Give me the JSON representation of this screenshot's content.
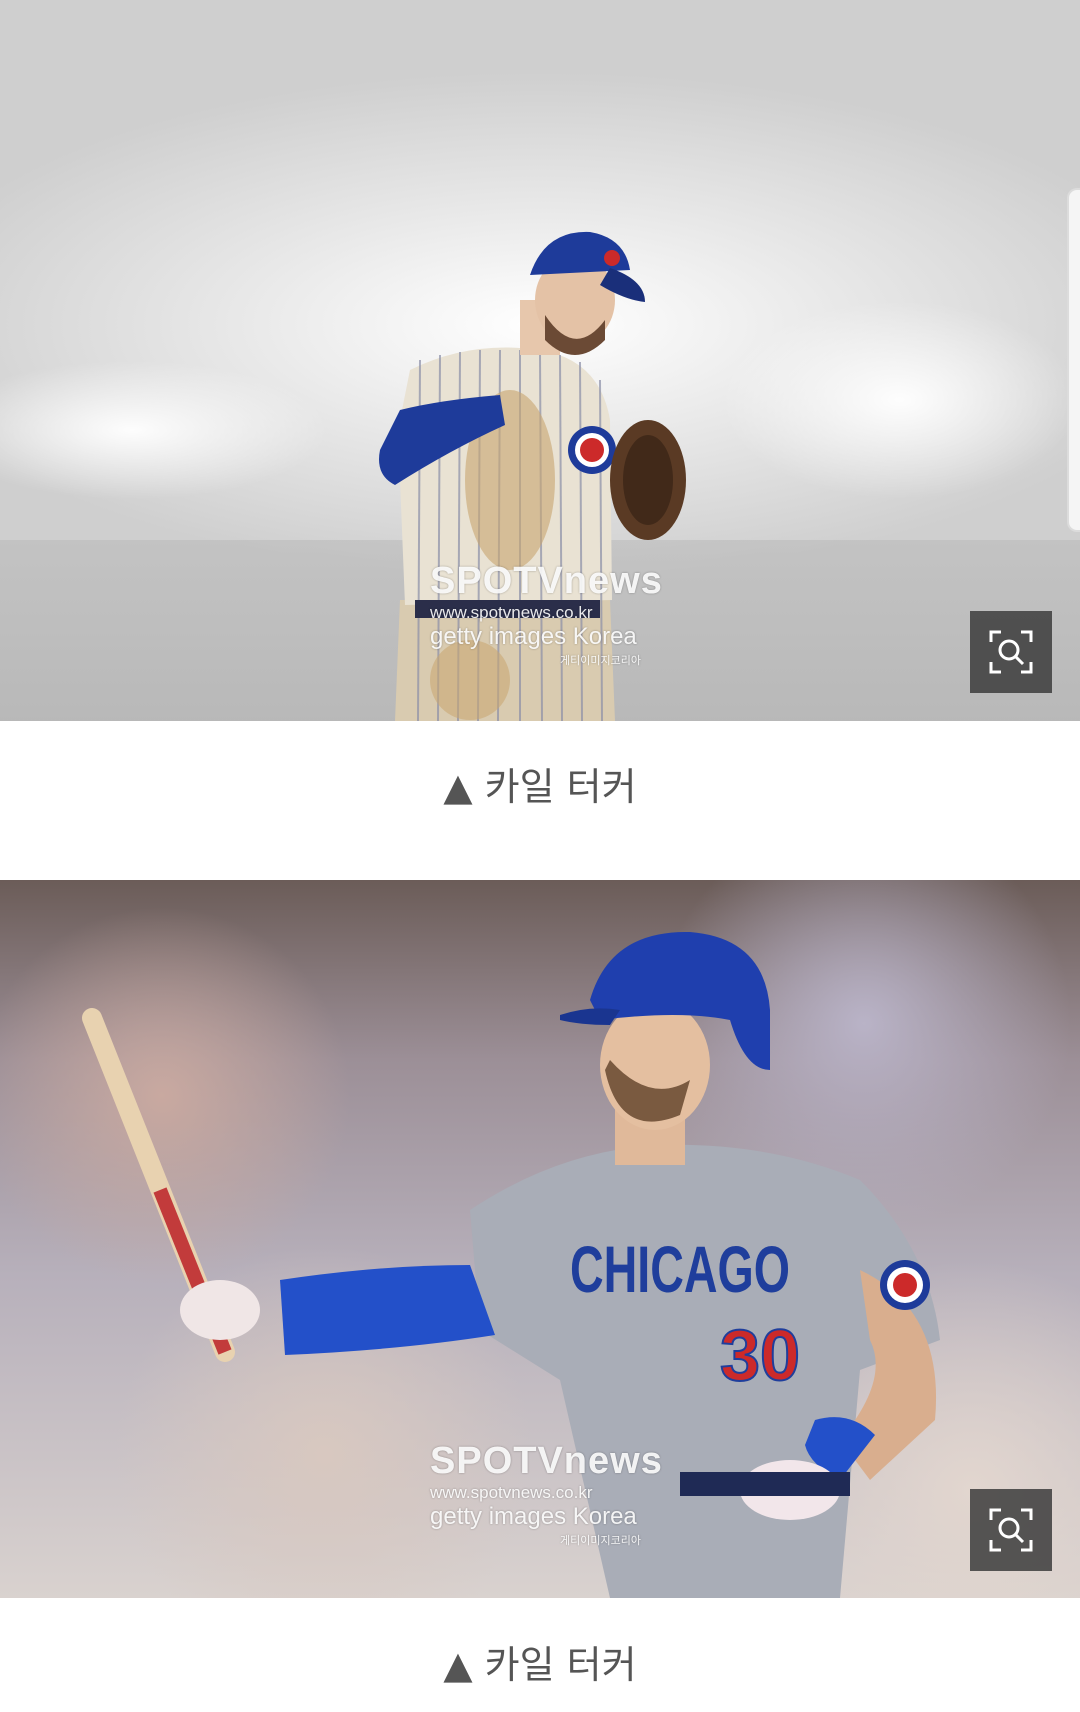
{
  "photos": [
    {
      "caption": "▲ 카일 터커",
      "watermark": {
        "brand": "SPOTVnews",
        "url": "www.spotvnews.co.kr",
        "credit": "getty images Korea",
        "credit_kr": "게티이미지코리아"
      },
      "zoom_icon": "zoom-search-icon"
    },
    {
      "caption": "▲ 카일 터커",
      "watermark": {
        "brand": "SPOTVnews",
        "url": "www.spotvnews.co.kr",
        "credit": "getty images Korea",
        "credit_kr": "게티이미지코리아"
      },
      "jersey_text": "CHICAGO",
      "jersey_number": "30",
      "zoom_icon": "zoom-search-icon"
    }
  ],
  "colors": {
    "cubs_blue": "#1f3e9c",
    "cubs_red": "#cc2a2a",
    "caption_text": "#555555",
    "zoom_bg": "#3c3c3c"
  }
}
